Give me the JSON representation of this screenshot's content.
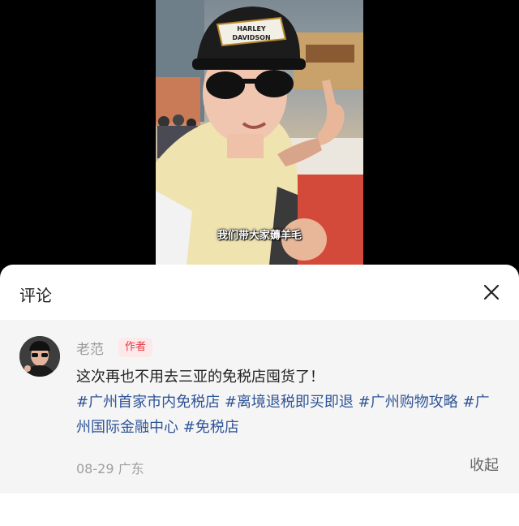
{
  "video": {
    "caption": "我们带大家薅羊毛",
    "cap_logo_text": "HARLEY DAVIDSON"
  },
  "comments_panel": {
    "title": "评论",
    "close_icon": "close-icon"
  },
  "comment": {
    "username": "老范",
    "author_badge": "作者",
    "text_line": "这次再也不用去三亚的免税店囤货了！",
    "tags": [
      "#广州首家市内免税店",
      "#离境退税即买即退",
      "#广州购物攻略",
      "#广州国际金融中心",
      "#免税店"
    ],
    "date": "08-29",
    "location": "广东",
    "collapse_label": "收起"
  },
  "colors": {
    "tag": "#2f5597",
    "badge_text": "#e8343f",
    "badge_bg": "#fde8ea",
    "comment_bg": "#f5f5f5"
  }
}
